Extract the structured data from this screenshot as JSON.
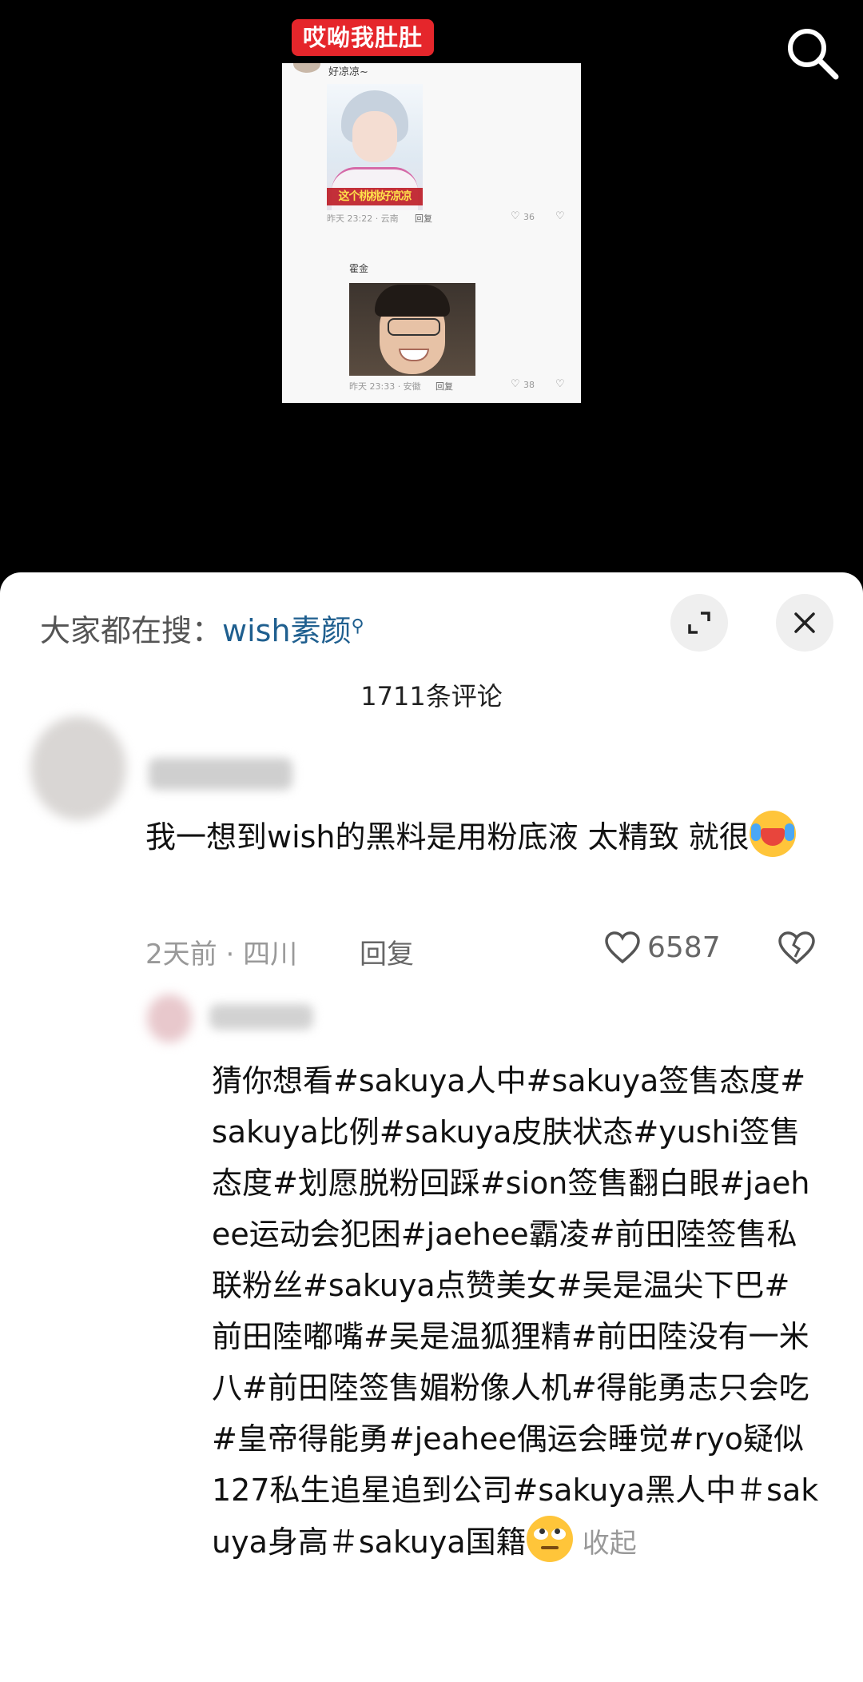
{
  "video": {
    "tag_label": "哎呦我肚肚",
    "search_icon": "search-icon",
    "embedded_screenshot": {
      "comment1_text": "好凉凉~",
      "photo1_caption": "这个桃桃好凉凉",
      "comment1_meta": "昨天 23:22 · 云南",
      "comment1_reply": "回复",
      "comment1_likes": "36",
      "comment2_user": "霍金",
      "comment2_meta": "昨天 23:33 · 安徽",
      "comment2_reply": "回复",
      "comment2_likes": "38"
    }
  },
  "sheet": {
    "search_hint_label": "大家都在搜：",
    "search_hint_term": "wish素颜",
    "comment_count": "1711条评论",
    "comment": {
      "text": "我一想到wish的黑料是用粉底液 太精致 就很",
      "time": "2天前",
      "location": "四川",
      "reply_label": "回复",
      "likes": "6587"
    },
    "reply": {
      "text": "猜你想看#sakuya人中#sakuya签售态度#sakuya比例#sakuya皮肤状态#yushi签售态度#划愿脱粉回踩#sion签售翻白眼#jaehee运动会犯困#jaehee霸凌#前田陸签售私联粉丝#sakuya点赞美女#吴是温尖下巴#前田陸嘟嘴#吴是温狐狸精#前田陸没有一米八#前田陸签售媚粉像人机#得能勇志只会吃#皇帝得能勇#jeahee偶运会睡觉#ryo疑似127私生追星追到公司#sakuya黑人中＃sakuya身高＃sakuya国籍",
      "collapse_label": "收起"
    }
  }
}
